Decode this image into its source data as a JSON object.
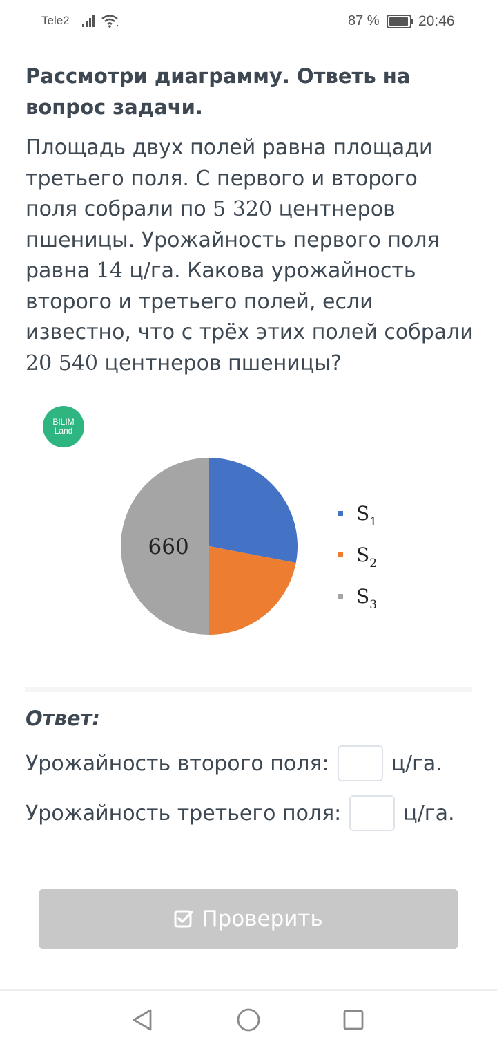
{
  "status_bar": {
    "carrier": "Tele2",
    "battery": "87 %",
    "time": "20:46"
  },
  "task": {
    "heading": "Рассмотри диаграмму. Ответь на вопрос задачи.",
    "problem_parts": [
      "Площадь двух полей равна площади третьего поля. С первого и второго поля собрали по ",
      "5 320",
      " центнеров пшеницы. Урожайность первого поля равна ",
      "14",
      " ц/га. Какова урожайность второго и третьего полей, если известно, что с трёх этих полей собрали ",
      "20 540",
      " центнеров пшеницы?"
    ]
  },
  "logo": {
    "line1": "BILIM",
    "line2": "Land"
  },
  "chart_data": {
    "type": "pie",
    "slices": [
      {
        "label": "S1",
        "value": 0.28,
        "color": "#4472c4"
      },
      {
        "label": "S2",
        "value": 0.22,
        "color": "#ed7d31"
      },
      {
        "label": "S3",
        "value": 0.5,
        "color": "#a5a5a5",
        "data_label": "660"
      }
    ],
    "legend": [
      {
        "base": "S",
        "sub": "1"
      },
      {
        "base": "S",
        "sub": "2"
      },
      {
        "base": "S",
        "sub": "3"
      }
    ],
    "legend_position": "right"
  },
  "answer": {
    "label": "Ответ:",
    "row2_label": "Урожайность второго поля:",
    "row2_unit": "ц/га.",
    "row2_value": "",
    "row3_label": "Урожайность третьего поля:",
    "row3_unit": "ц/га.",
    "row3_value": ""
  },
  "button": {
    "label": "Проверить",
    "color": "#c8c8c8"
  },
  "icons": {
    "check": "check-square-icon",
    "nav": [
      "back-icon",
      "home-icon",
      "recent-apps-icon"
    ]
  }
}
